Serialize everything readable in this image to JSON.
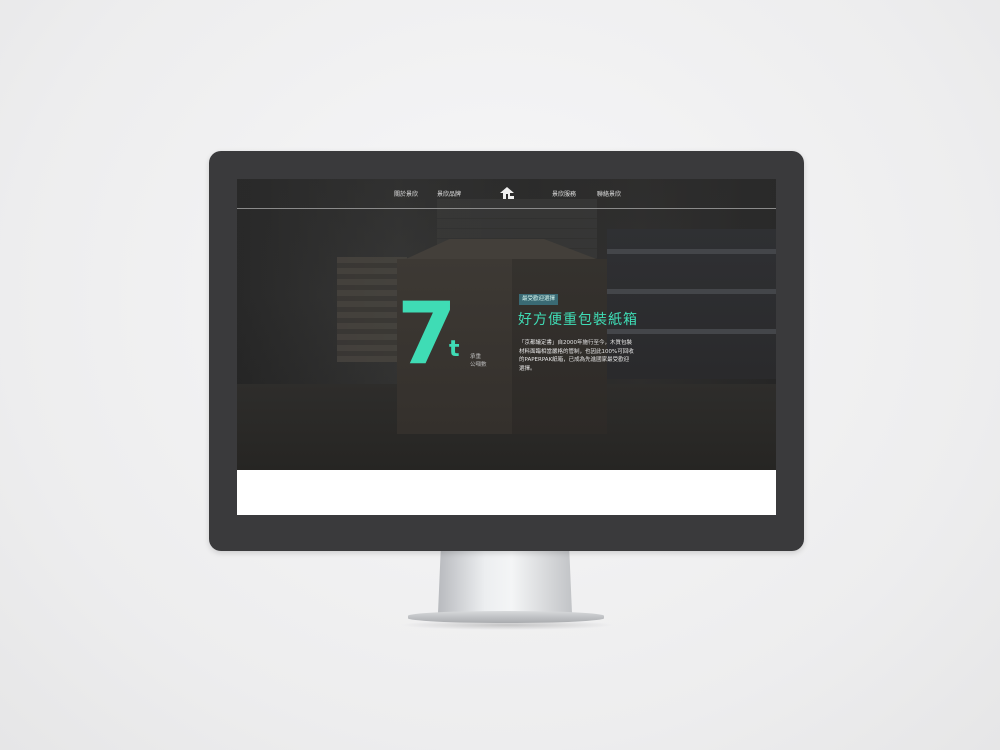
{
  "nav": {
    "items_left": [
      "關於景欣",
      "景欣品牌"
    ],
    "items_right": [
      "景欣服務",
      "聯絡景欣"
    ],
    "logo": "js-logo-icon"
  },
  "hero": {
    "big_number": "7",
    "unit": "t",
    "unit_note": [
      "承重",
      "公噸數"
    ],
    "badge": "最受歡迎選擇",
    "headline": "好方便重包裝紙箱",
    "description": "「京都議定書」自2000年施行至今，木質包裝材料面臨相當嚴格的管制，也因此100%可回收的PAPERPAK紙箱，已成為先進國家最受歡迎選擇。"
  },
  "colors": {
    "accent": "#3fdcb5",
    "badge_bg": "#3a6a74",
    "bezel": "#3a3a3c"
  }
}
